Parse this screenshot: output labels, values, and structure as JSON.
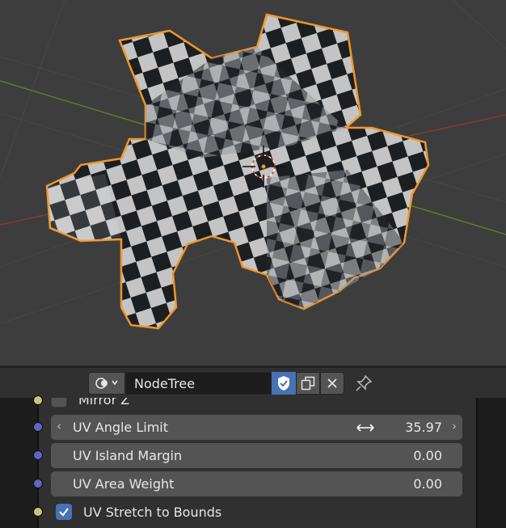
{
  "header": {
    "editor_type_icon": "node-editor-icon",
    "node_tree_name": "NodeTree",
    "fake_user_icon": "shield-check-icon",
    "duplicate_icon": "duplicate-icon",
    "unlink_icon": "close-icon",
    "pin_icon": "pin-icon"
  },
  "node": {
    "mirror_label": "Mirror Z",
    "angle_limit": {
      "label": "UV Angle Limit",
      "value": "35.97"
    },
    "island_margin": {
      "label": "UV Island Margin",
      "value": "0.00"
    },
    "area_weight": {
      "label": "UV Area Weight",
      "value": "0.00"
    },
    "stretch": {
      "label": "UV Stretch to Bounds",
      "checked": true
    }
  },
  "colors": {
    "accent": "#4772b3",
    "selection_outline": "#f0962a",
    "vector_socket": "#6363c7",
    "bool_socket": "#c7c77a"
  }
}
